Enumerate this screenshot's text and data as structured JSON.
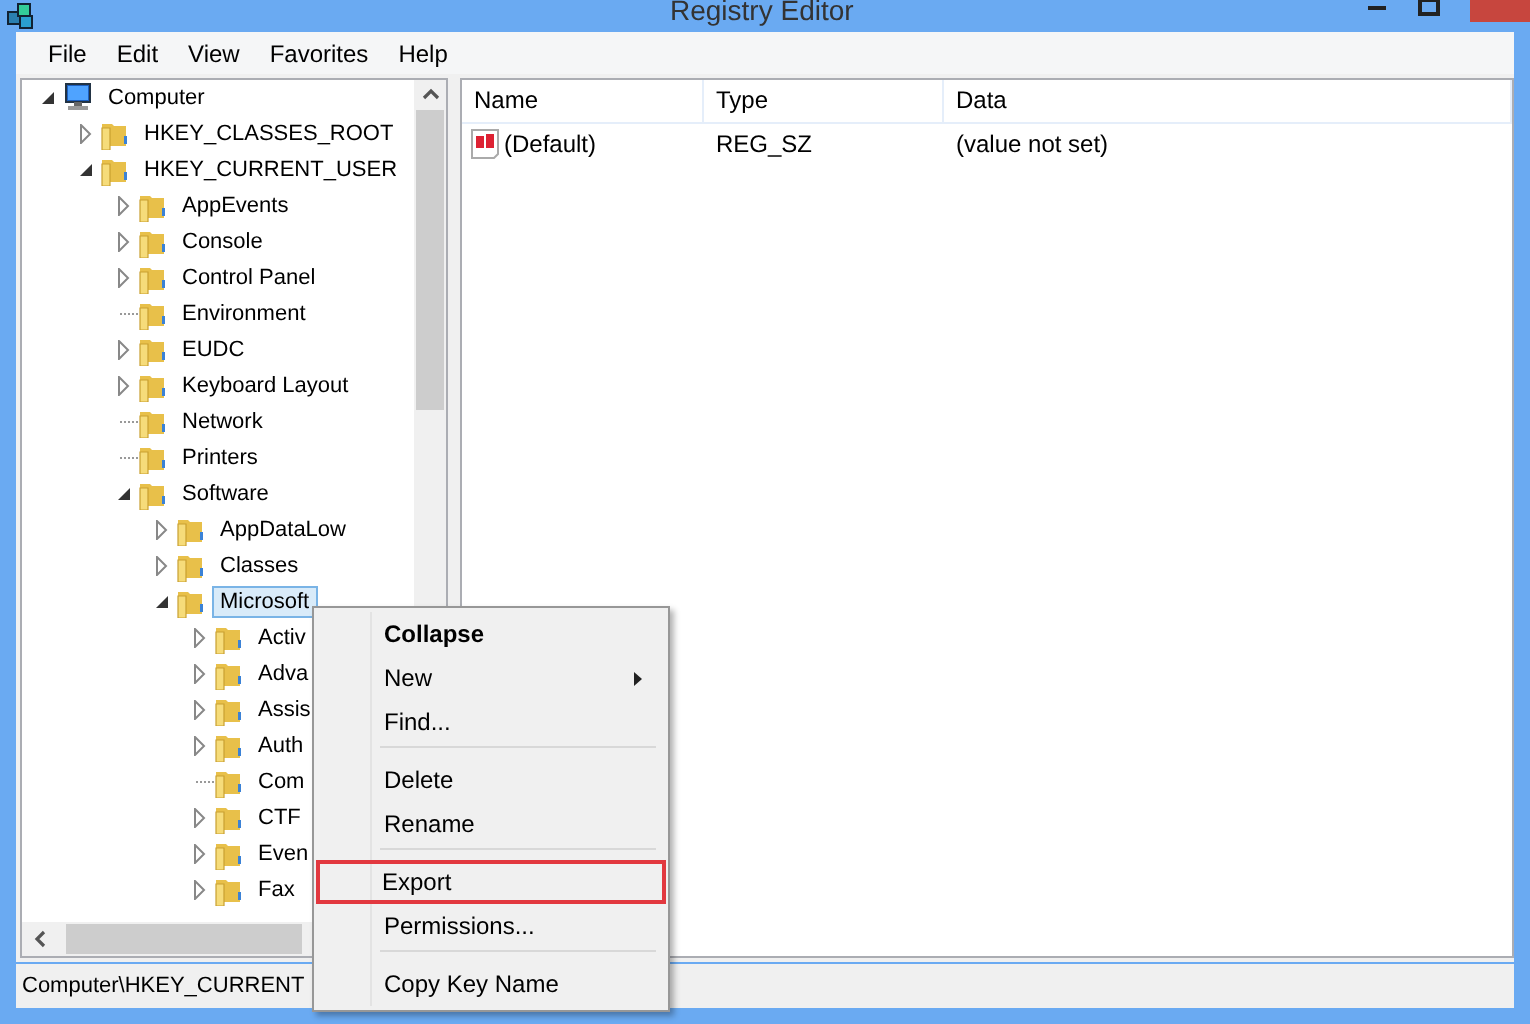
{
  "window": {
    "title": "Registry Editor"
  },
  "menu_bar": [
    "File",
    "Edit",
    "View",
    "Favorites",
    "Help"
  ],
  "tree": [
    {
      "label": "Computer",
      "kind": "computer",
      "expanded": true,
      "selected": false,
      "children": [
        {
          "label": "HKEY_CLASSES_ROOT",
          "kind": "branch",
          "expanded": false,
          "selected": false
        },
        {
          "label": "HKEY_CURRENT_USER",
          "kind": "branch",
          "expanded": true,
          "selected": false,
          "children": [
            {
              "label": "AppEvents",
              "kind": "branch",
              "expanded": false,
              "selected": false
            },
            {
              "label": "Console",
              "kind": "branch",
              "expanded": false,
              "selected": false
            },
            {
              "label": "Control Panel",
              "kind": "branch",
              "expanded": false,
              "selected": false
            },
            {
              "label": "Environment",
              "kind": "leaf",
              "selected": false
            },
            {
              "label": "EUDC",
              "kind": "branch",
              "expanded": false,
              "selected": false
            },
            {
              "label": "Keyboard Layout",
              "kind": "branch",
              "expanded": false,
              "selected": false
            },
            {
              "label": "Network",
              "kind": "leaf",
              "selected": false
            },
            {
              "label": "Printers",
              "kind": "leaf",
              "selected": false
            },
            {
              "label": "Software",
              "kind": "branch",
              "expanded": true,
              "selected": false,
              "children": [
                {
                  "label": "AppDataLow",
                  "kind": "branch",
                  "expanded": false,
                  "selected": false
                },
                {
                  "label": "Classes",
                  "kind": "branch",
                  "expanded": false,
                  "selected": false
                },
                {
                  "label": "Microsoft",
                  "kind": "branch",
                  "expanded": true,
                  "selected": true,
                  "children": [
                    {
                      "label": "Activ",
                      "kind": "branch",
                      "expanded": false,
                      "selected": false
                    },
                    {
                      "label": "Adva",
                      "kind": "branch",
                      "expanded": false,
                      "selected": false
                    },
                    {
                      "label": "Assis",
                      "kind": "branch",
                      "expanded": false,
                      "selected": false
                    },
                    {
                      "label": "Auth",
                      "kind": "branch",
                      "expanded": false,
                      "selected": false
                    },
                    {
                      "label": "Com",
                      "kind": "leaf",
                      "selected": false
                    },
                    {
                      "label": "CTF",
                      "kind": "branch",
                      "expanded": false,
                      "selected": false
                    },
                    {
                      "label": "Even",
                      "kind": "branch",
                      "expanded": false,
                      "selected": false
                    },
                    {
                      "label": "Fax",
                      "kind": "branch",
                      "expanded": false,
                      "selected": false
                    }
                  ]
                }
              ]
            }
          ]
        }
      ]
    }
  ],
  "values_table": {
    "columns": [
      "Name",
      "Type",
      "Data"
    ],
    "rows": [
      {
        "name": "(Default)",
        "type": "REG_SZ",
        "data": "(value not set)"
      }
    ]
  },
  "status_bar": "Computer\\HKEY_CURRENT",
  "context_menu": [
    {
      "label": "Collapse",
      "default": true,
      "submenu": false,
      "marked": false,
      "separator_after": false
    },
    {
      "label": "New",
      "default": false,
      "submenu": true,
      "marked": false,
      "separator_after": false
    },
    {
      "label": "Find...",
      "default": false,
      "submenu": false,
      "marked": false,
      "separator_after": true
    },
    {
      "label": "Delete",
      "default": false,
      "submenu": false,
      "marked": false,
      "separator_after": false
    },
    {
      "label": "Rename",
      "default": false,
      "submenu": false,
      "marked": false,
      "separator_after": true
    },
    {
      "label": "Export",
      "default": false,
      "submenu": false,
      "marked": true,
      "separator_after": false
    },
    {
      "label": "Permissions...",
      "default": false,
      "submenu": false,
      "marked": false,
      "separator_after": true
    },
    {
      "label": "Copy Key Name",
      "default": false,
      "submenu": false,
      "marked": false,
      "separator_after": false
    }
  ]
}
